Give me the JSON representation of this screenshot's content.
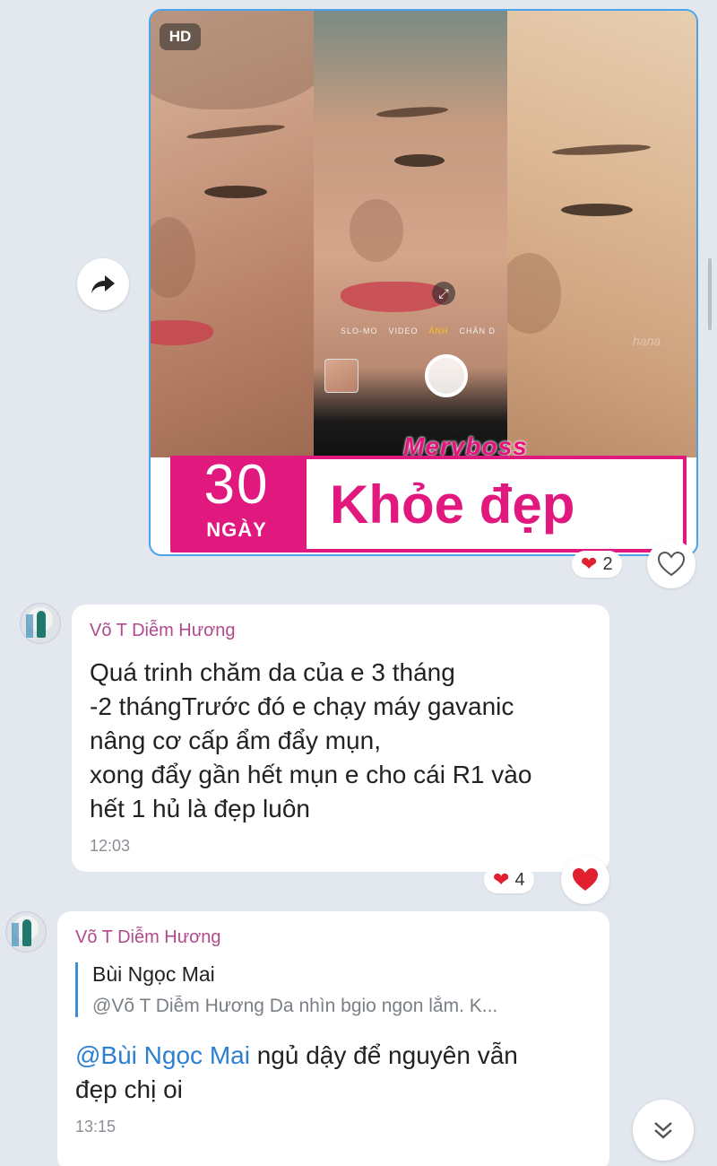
{
  "image_message": {
    "hd_badge": "HD",
    "camera_modes": [
      "SLO-MO",
      "VIDEO",
      "ẢNH",
      "CHÂN D"
    ],
    "brand": "Meryboss",
    "banner_number": "30",
    "banner_unit": "NGÀY",
    "banner_title": "Khỏe đẹp",
    "reactions": {
      "count": "2"
    }
  },
  "messages": [
    {
      "sender": "Võ T Diễm Hương",
      "text": "Quá trinh chăm da của e 3 tháng\n-2 thángTrước đó e chạy máy gavanic\nnâng cơ cấp ẩm đẩy mụn,\nxong đẩy gần hết mụn e cho cái R1 vào\nhết 1 hủ là đẹp luôn",
      "time": "12:03",
      "reactions": {
        "count": "4"
      }
    },
    {
      "sender": "Võ T Diễm Hương",
      "quote": {
        "name": "Bùi Ngọc Mai",
        "text": "@Võ T Diễm Hương Da nhìn bgio ngon lắm. K..."
      },
      "mention": "@Bùi Ngọc Mai",
      "text": " ngủ dậy để nguyên vẫn\nđẹp chị oi",
      "time": "13:15"
    }
  ],
  "colors": {
    "accent_pink": "#e1197e",
    "sender_name": "#b04a8d",
    "mention_blue": "#2d7fd0",
    "heart_red": "#e0202f",
    "chat_background": "#e3e8ef"
  }
}
